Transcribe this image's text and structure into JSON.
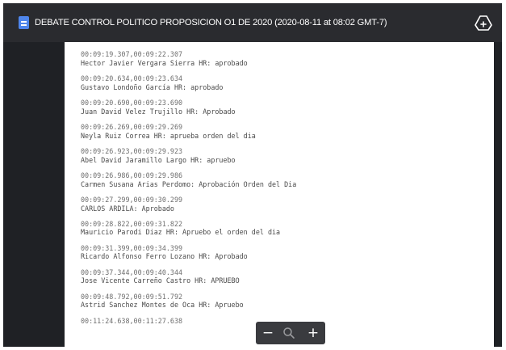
{
  "header": {
    "title": "DEBATE CONTROL POLITICO PROPOSICION O1 DE 2020 (2020-08-11 at 08:02 GMT-7)",
    "file_icon": "document-icon",
    "add_icon": "add-to-drive-icon"
  },
  "transcript": {
    "entries": [
      {
        "time": "00:09:19.307,00:09:22.307",
        "text": "Hector Javier Vergara Sierra HR: aprobado"
      },
      {
        "time": "00:09:20.634,00:09:23.634",
        "text": "Gustavo Londoño García HR: aprobado"
      },
      {
        "time": "00:09:20.690,00:09:23.690",
        "text": "Juan David Velez Trujillo HR: Aprobado"
      },
      {
        "time": "00:09:26.269,00:09:29.269",
        "text": "Neyla Ruiz Correa HR: aprueba orden del dia"
      },
      {
        "time": "00:09:26.923,00:09:29.923",
        "text": "Abel David Jaramillo Largo HR: apruebo"
      },
      {
        "time": "00:09:26.986,00:09:29.986",
        "text": "Carmen Susana Arias Perdomo: Aprobación Orden del Dia"
      },
      {
        "time": "00:09:27.299,00:09:30.299",
        "text": "CARLOS ARDILA: Aprobado"
      },
      {
        "time": "00:09:28.822,00:09:31.822",
        "text": "Mauricio Parodi Diaz HR: Apruebo el orden del dia"
      },
      {
        "time": "00:09:31.399,00:09:34.399",
        "text": "Ricardo Alfonso Ferro Lozano HR: Aprobado"
      },
      {
        "time": "00:09:37.344,00:09:40.344",
        "text": "Jose Vicente Carreño Castro HR: APRUEBO"
      },
      {
        "time": "00:09:48.792,00:09:51.792",
        "text": "Astrid Sanchez Montes de Oca HR: Apruebo"
      },
      {
        "time": "00:11:24.638,00:11:27.638",
        "text": ""
      }
    ]
  },
  "zoom_controls": {
    "zoom_out_label": "−",
    "zoom_in_label": "+",
    "search_icon": "magnifier-icon"
  },
  "colors": {
    "background": "#1f2125",
    "titlebar": "#2a2b2f",
    "document_icon": "#4f86ec",
    "zoom_bar": "#3a3b3f"
  }
}
